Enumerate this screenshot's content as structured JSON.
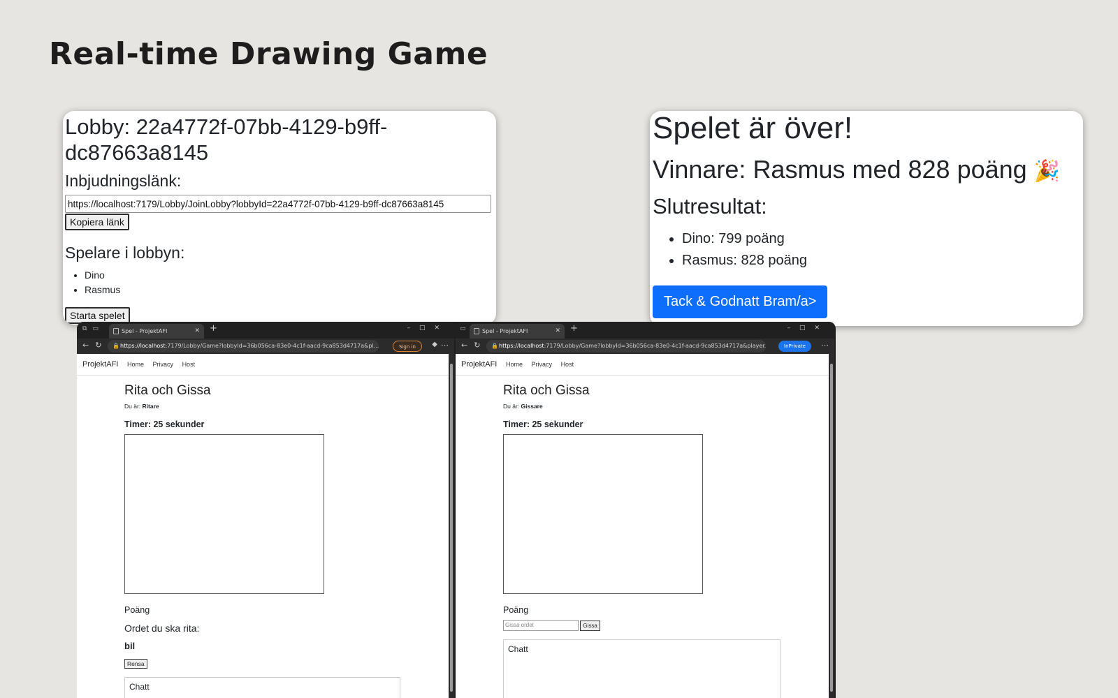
{
  "page": {
    "title": "Real-time Drawing Game"
  },
  "lobby": {
    "heading": "Lobby: 22a4772f-07bb-4129-b9ff-dc87663a8145",
    "invite_label": "Inbjudningslänk:",
    "invite_url": "https://localhost:7179/Lobby/JoinLobby?lobbyId=22a4772f-07bb-4129-b9ff-dc87663a8145",
    "copy_label": "Kopiera länk",
    "players_title": "Spelare i lobbyn:",
    "players": [
      "Dino",
      "Rasmus"
    ],
    "start_label": "Starta spelet"
  },
  "result": {
    "title": "Spelet är över!",
    "winner": "Vinnare: Rasmus med 828 poäng",
    "winner_emoji": "🎉",
    "final_title": "Slutresultat:",
    "scores": [
      "Dino: 799 poäng",
      "Rasmus: 828 poäng"
    ],
    "thanks_label": "Tack & Godnatt Bram/a>"
  },
  "browser_left": {
    "tab_title": "Spel - ProjektAFI",
    "url_host": "https://localhost",
    "url_rest": ":7179/Lobby/Game?lobbyId=36b056ca-83e0-4c1f-aacd-9ca853d4717a&pl...",
    "signin_label": "Sign in",
    "brand": "ProjektAFI",
    "nav": [
      "Home",
      "Privacy",
      "Host"
    ],
    "game_title": "Rita och Gissa",
    "role_prefix": "Du är:",
    "role": "Ritare",
    "timer": "Timer: 25 sekunder",
    "points_label": "Poäng",
    "word_label": "Ordet du ska rita:",
    "word": "bil",
    "clear_label": "Rensa",
    "chat_title": "Chatt"
  },
  "browser_right": {
    "tab_title": "Spel - ProjektAFI",
    "url_host": "https://localhost",
    "url_rest": ":7179/Lobby/Game?lobbyId=36b056ca-83e0-4c1f-aacd-9ca853d4717a&player...",
    "inprivate_label": "InPrivate",
    "brand": "ProjektAFI",
    "nav": [
      "Home",
      "Privacy",
      "Host"
    ],
    "game_title": "Rita och Gissa",
    "role_prefix": "Du är:",
    "role": "Gissare",
    "timer": "Timer: 25 sekunder",
    "points_label": "Poäng",
    "guess_placeholder": "Gissa ordet",
    "guess_label": "Gissa",
    "chat_title": "Chatt"
  },
  "colors": {
    "primary": "#0d6efd",
    "background": "#e6e5e2"
  }
}
